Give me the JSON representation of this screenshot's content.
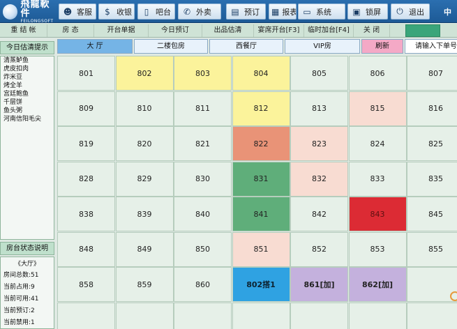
{
  "app": {
    "logo_cn": "飛龍軟件",
    "logo_en": "FEILONGSOFT",
    "corner_text": "中"
  },
  "nav": [
    {
      "label": "客服",
      "icon": "headset-icon",
      "glyph": "☻"
    },
    {
      "label": "收银",
      "icon": "dollar-icon",
      "glyph": "$"
    },
    {
      "label": "吧台",
      "icon": "phone-device-icon",
      "glyph": "▯"
    },
    {
      "label": "外卖",
      "icon": "telephone-icon",
      "glyph": "✆"
    },
    {
      "label": "预订",
      "icon": "notepad-icon",
      "glyph": "▤"
    },
    {
      "label": "报表",
      "icon": "report-icon",
      "glyph": "▦"
    },
    {
      "label": "系统",
      "icon": "monitor-icon",
      "glyph": "▭"
    },
    {
      "label": "锁屏",
      "icon": "lock-icon",
      "glyph": "▣"
    },
    {
      "label": "退出",
      "icon": "power-icon",
      "glyph": "⏻"
    }
  ],
  "functions": [
    "重 结 帐",
    "房  态",
    "开台单据",
    "今日预订",
    "出品估清",
    "宴席开台[F3]",
    "临时加台[F4]",
    "关  闭"
  ],
  "left_panel": {
    "estimate_title": "今日估清提示",
    "estimate_items": [
      "清蒸鲈鱼",
      "虎皮扣肉",
      "炸米豆",
      "烤全羊",
      "宫廷鲍鱼",
      "千层饼",
      "鱼头粥",
      "河南信阳毛尖"
    ],
    "status_title": "房台状态说明",
    "status_hall": "《大厅》",
    "status_lines": [
      "房间总数:51",
      "当前占用:9",
      "当前可用:41",
      "当前预订:2",
      "当前禁用:1"
    ]
  },
  "tabs": [
    "大  厅",
    "二楼包房",
    "西餐厅",
    "VIP房",
    "刷新"
  ],
  "search": {
    "placeholder": "请输入下单号"
  },
  "rooms": [
    [
      {
        "n": "801",
        "s": "normal"
      },
      {
        "n": "802",
        "s": "yellow"
      },
      {
        "n": "803",
        "s": "yellow"
      },
      {
        "n": "804",
        "s": "yellow"
      },
      {
        "n": "805",
        "s": "normal"
      },
      {
        "n": "806",
        "s": "normal"
      },
      {
        "n": "807",
        "s": "normal"
      }
    ],
    [
      {
        "n": "809",
        "s": "normal"
      },
      {
        "n": "810",
        "s": "normal"
      },
      {
        "n": "811",
        "s": "normal"
      },
      {
        "n": "812",
        "s": "yellow"
      },
      {
        "n": "813",
        "s": "normal"
      },
      {
        "n": "815",
        "s": "pink"
      },
      {
        "n": "816",
        "s": "normal"
      }
    ],
    [
      {
        "n": "819",
        "s": "normal"
      },
      {
        "n": "820",
        "s": "normal"
      },
      {
        "n": "821",
        "s": "normal"
      },
      {
        "n": "822",
        "s": "salmon"
      },
      {
        "n": "823",
        "s": "pink"
      },
      {
        "n": "824",
        "s": "normal"
      },
      {
        "n": "825",
        "s": "normal"
      }
    ],
    [
      {
        "n": "828",
        "s": "normal"
      },
      {
        "n": "829",
        "s": "normal"
      },
      {
        "n": "830",
        "s": "normal"
      },
      {
        "n": "831",
        "s": "green"
      },
      {
        "n": "832",
        "s": "pink"
      },
      {
        "n": "833",
        "s": "normal"
      },
      {
        "n": "835",
        "s": "normal"
      }
    ],
    [
      {
        "n": "838",
        "s": "normal"
      },
      {
        "n": "839",
        "s": "normal"
      },
      {
        "n": "840",
        "s": "normal"
      },
      {
        "n": "841",
        "s": "green"
      },
      {
        "n": "842",
        "s": "normal"
      },
      {
        "n": "843",
        "s": "red"
      },
      {
        "n": "845",
        "s": "normal"
      }
    ],
    [
      {
        "n": "848",
        "s": "normal"
      },
      {
        "n": "849",
        "s": "normal"
      },
      {
        "n": "850",
        "s": "normal"
      },
      {
        "n": "851",
        "s": "pink"
      },
      {
        "n": "852",
        "s": "normal"
      },
      {
        "n": "853",
        "s": "normal"
      },
      {
        "n": "855",
        "s": "normal"
      }
    ],
    [
      {
        "n": "858",
        "s": "normal"
      },
      {
        "n": "859",
        "s": "normal"
      },
      {
        "n": "860",
        "s": "normal"
      },
      {
        "n": "802搭1",
        "s": "blue"
      },
      {
        "n": "861[加]",
        "s": "purple"
      },
      {
        "n": "862[加]",
        "s": "purple"
      },
      {
        "n": "",
        "s": "normal"
      }
    ],
    [
      {
        "n": "",
        "s": "normal"
      },
      {
        "n": "",
        "s": "normal"
      },
      {
        "n": "",
        "s": "normal"
      },
      {
        "n": "",
        "s": "normal"
      },
      {
        "n": "",
        "s": "normal"
      },
      {
        "n": "",
        "s": "normal"
      },
      {
        "n": "",
        "s": "normal"
      }
    ]
  ]
}
